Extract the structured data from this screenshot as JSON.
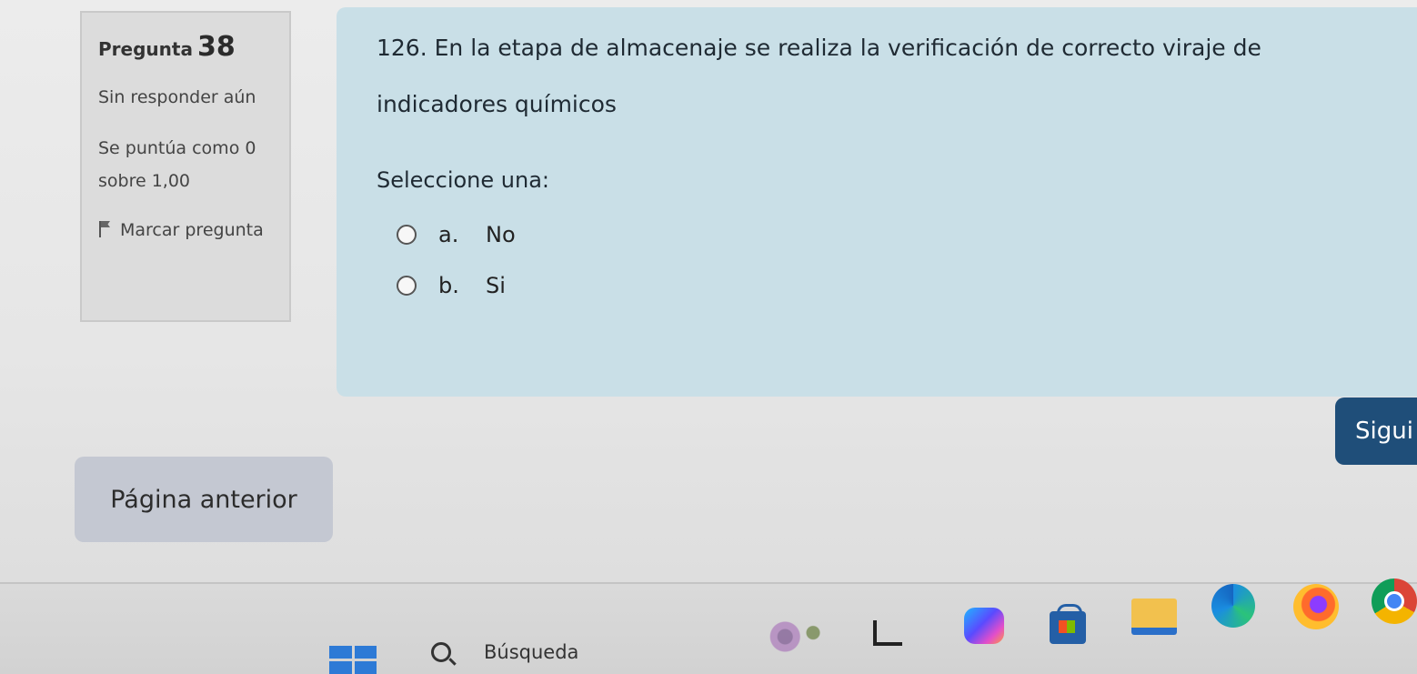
{
  "question_info": {
    "label": "Pregunta",
    "number": "38",
    "status": "Sin responder aún",
    "score": "Se puntúa como 0 sobre 1,00",
    "flag_label": "Marcar pregunta"
  },
  "question": {
    "text": "126. En la etapa de almacenaje se realiza la verificación de correcto viraje de indicadores químicos",
    "select_label": "Seleccione una:",
    "options": [
      {
        "letter": "a.",
        "label": "No"
      },
      {
        "letter": "b.",
        "label": "Si"
      }
    ]
  },
  "navigation": {
    "next_label": "Sigui",
    "prev_label": "Página anterior"
  },
  "taskbar": {
    "search_label": "Búsqueda",
    "icons": [
      "windows-start-icon",
      "search-icon",
      "widgets-icon",
      "task-view-icon",
      "copilot-icon",
      "store-icon",
      "file-explorer-icon",
      "edge-icon",
      "firefox-icon",
      "chrome-icon"
    ]
  },
  "colors": {
    "question_bg": "#c9dfe7",
    "next_button": "#1f4e79",
    "prev_button": "#c4c8d2"
  }
}
